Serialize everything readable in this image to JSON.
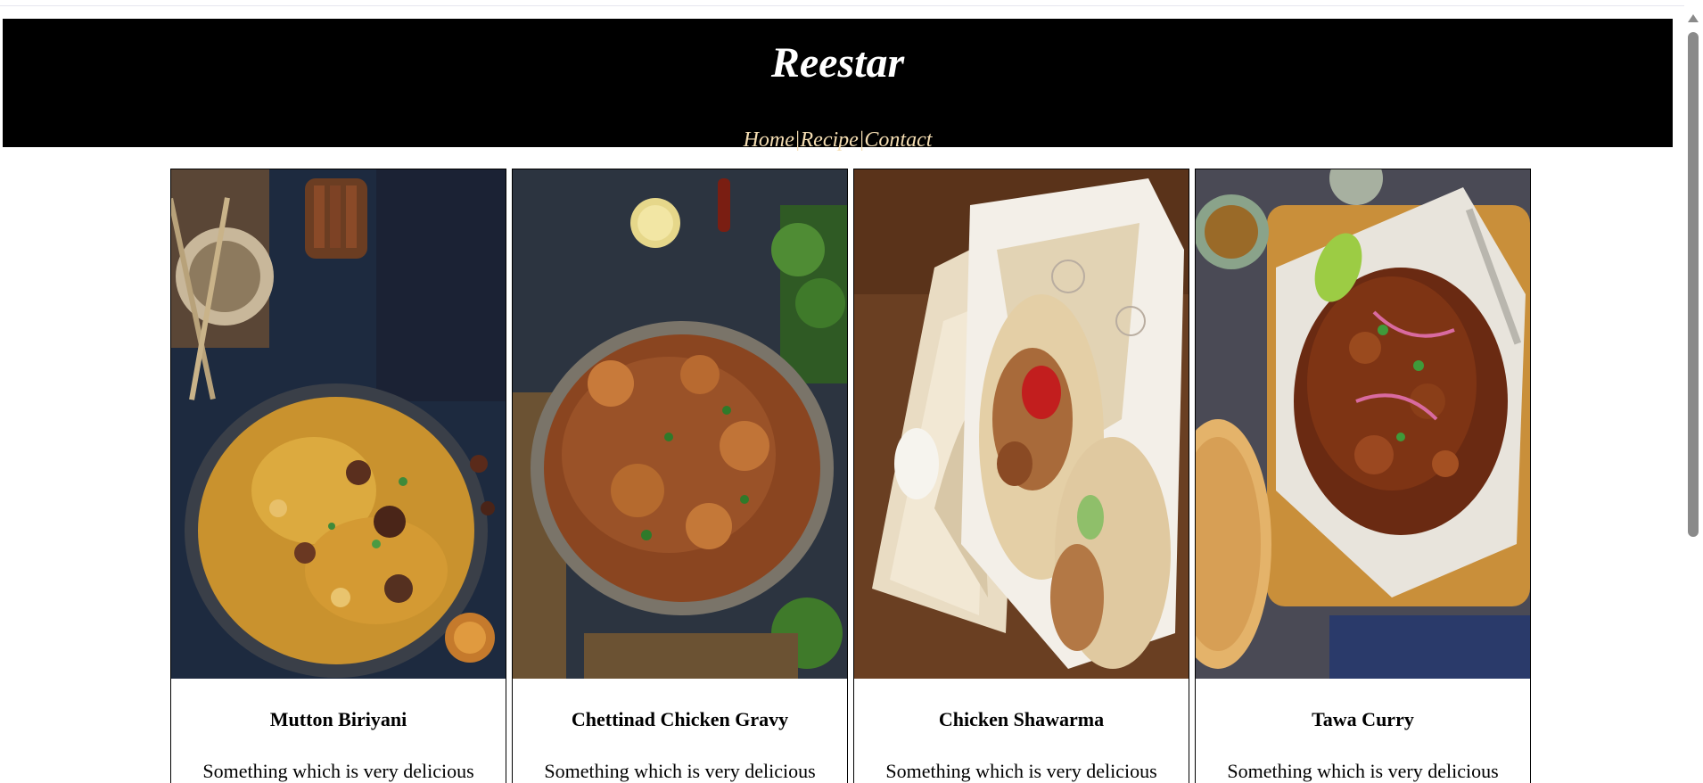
{
  "header": {
    "title": "Reestar",
    "nav": [
      {
        "label": "Home"
      },
      {
        "label": "Recipe"
      },
      {
        "label": "Contact"
      }
    ],
    "separator": "|",
    "background": "#000000",
    "title_color": "#ffffff",
    "nav_color": "#f5deb3"
  },
  "cards": [
    {
      "title": "Mutton Biriyani",
      "description": "Something which is very delicious",
      "image": "mutton-biriyani-photo"
    },
    {
      "title": "Chettinad Chicken Gravy",
      "description": "Something which is very delicious",
      "image": "chettinad-chicken-gravy-photo"
    },
    {
      "title": "Chicken Shawarma",
      "description": "Something which is very delicious",
      "image": "chicken-shawarma-photo"
    },
    {
      "title": "Tawa Curry",
      "description": "Something which is very delicious",
      "image": "tawa-curry-photo"
    }
  ]
}
